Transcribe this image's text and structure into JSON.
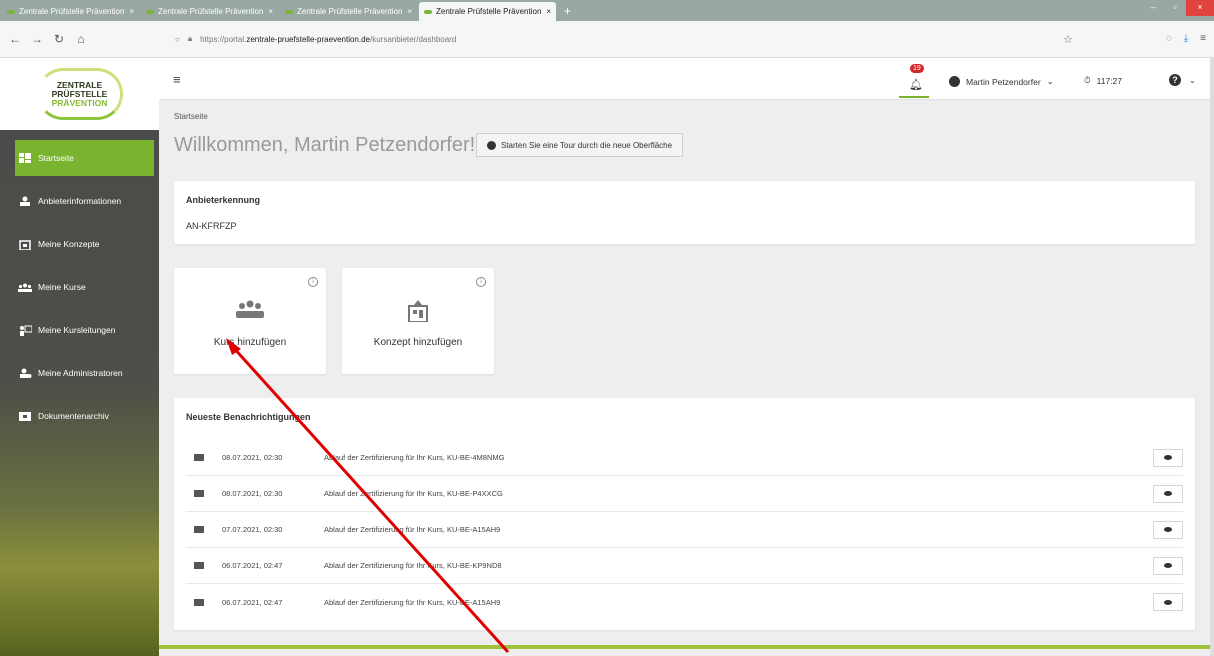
{
  "browser": {
    "tabs": [
      {
        "title": "Zentrale Prüfstelle Prävention - ",
        "close": "×"
      },
      {
        "title": "Zentrale Prüfstelle Prävention - ",
        "close": "×"
      },
      {
        "title": "Zentrale Prüfstelle Prävention - ",
        "close": "×"
      },
      {
        "title": "Zentrale Prüfstelle Prävention - ",
        "close": "×"
      }
    ],
    "new_tab": "+",
    "url_prefix": "https://portal.",
    "url_domain": "zentrale-pruefstelle-praevention.de",
    "url_path": "/kursanbieter/dashboard",
    "window_controls": [
      "–",
      "▫",
      "×"
    ]
  },
  "logo": {
    "line1": "ZENTRALE",
    "line2": "PRÜFSTELLE",
    "line3": "PRÄVENTION"
  },
  "sidebar": {
    "items": [
      {
        "label": "Startseite",
        "icon": "dashboard-icon"
      },
      {
        "label": "Anbieterinformationen",
        "icon": "provider-icon"
      },
      {
        "label": "Meine Konzepte",
        "icon": "concept-icon"
      },
      {
        "label": "Meine Kurse",
        "icon": "group-icon"
      },
      {
        "label": "Meine Kursleitungen",
        "icon": "instructor-icon"
      },
      {
        "label": "Meine Administratoren",
        "icon": "admin-icon"
      },
      {
        "label": "Dokumentenarchiv",
        "icon": "folder-icon"
      }
    ]
  },
  "topbar": {
    "notifications_count": "19",
    "user_name": "Martin Petzendorfer",
    "timer": "117:27",
    "help": "?"
  },
  "page": {
    "breadcrumb": "Startseite",
    "welcome": "Willkommen, Martin Petzendorfer!",
    "tour_button": "Starten Sie eine Tour durch die neue Oberfläche"
  },
  "provider": {
    "title": "Anbieterkennung",
    "value": "AN-KFRFZP"
  },
  "tiles": [
    {
      "label": "Kurs hinzufügen",
      "icon": "group-icon"
    },
    {
      "label": "Konzept hinzufügen",
      "icon": "concept-icon"
    }
  ],
  "notifications": {
    "title": "Neueste Benachrichtigungen",
    "rows": [
      {
        "date": "08.07.2021, 02:30",
        "message": "Ablauf der Zertifizierung für Ihr Kurs, KU-BE-4M8NMG"
      },
      {
        "date": "08.07.2021, 02:30",
        "message": "Ablauf der Zertifizierung für Ihr Kurs, KU-BE-P4XXCG"
      },
      {
        "date": "07.07.2021, 02:30",
        "message": "Ablauf der Zertifizierung für Ihr Kurs, KU-BE-A15AH9"
      },
      {
        "date": "06.07.2021, 02:47",
        "message": "Ablauf der Zertifizierung für Ihr Kurs, KU-BE-KP9ND8"
      },
      {
        "date": "06.07.2021, 02:47",
        "message": "Ablauf der Zertifizierung für Ihr Kurs, KU-BE-A15AH9"
      }
    ]
  },
  "colors": {
    "accent_green": "#7ab32e",
    "annotation_arrow": "#e00000"
  }
}
